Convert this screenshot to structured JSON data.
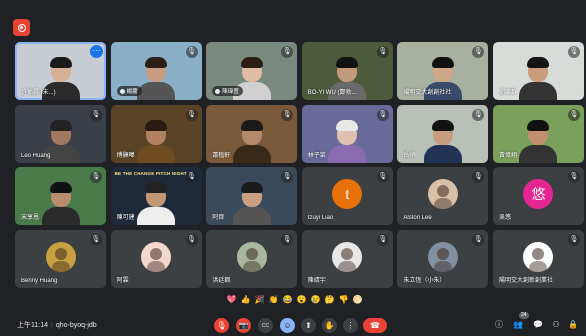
{
  "meeting": {
    "time": "上午11:14",
    "separator": "|",
    "code": "qho-byoq-jdb",
    "participant_count": "24"
  },
  "colors": {
    "background": "#202124",
    "tile": "#3c4043",
    "end_call": "#ea4335",
    "active_border": "#8ab4f8"
  },
  "tiles": [
    {
      "name": "許佑昇 (未...)",
      "kind": "video",
      "bg": "#c8cdd4",
      "skin": "#d8b098",
      "hair": "#1a1a1a",
      "shirt": "#2a2a2a",
      "active": true,
      "more": true
    },
    {
      "name": "楊藺",
      "kind": "video",
      "style": "pill",
      "bg": "#8ab0c8",
      "skin": "#c99d84",
      "hair": "#2a2018",
      "shirt": "#555",
      "mic": true
    },
    {
      "name": "陳瑋萱",
      "kind": "video",
      "style": "pill",
      "bg": "#7a8a80",
      "skin": "#e0bca6",
      "hair": "#2a1e16",
      "shirt": "#d0d0d0",
      "mic": true
    },
    {
      "name": "BO-YI WU (鄭勃...",
      "kind": "video",
      "bg": "#4d5a3c",
      "skin": "#c49a7c",
      "hair": "#111",
      "shirt": "#6a6a6a",
      "mic": true
    },
    {
      "name": "陽明交大創創社社",
      "kind": "video",
      "bg": "#a8b0a0",
      "skin": "#d0a888",
      "hair": "#111",
      "shirt": "#3a4a6a",
      "mic": true
    },
    {
      "name": "劉樂群",
      "kind": "video",
      "bg": "#d8dcd8",
      "skin": "#c89c7c",
      "hair": "#151515",
      "shirt": "#333",
      "mic": true
    },
    {
      "name": "Leo Huang",
      "kind": "video",
      "bg": "#3a3f48",
      "skin": "#a07860",
      "hair": "#222",
      "shirt": "#444",
      "mic": true
    },
    {
      "name": "傅顥暐",
      "kind": "video",
      "bg": "#5a4428",
      "skin": "#b08060",
      "hair": "#2a1a10",
      "shirt": "#704a20",
      "mic": true
    },
    {
      "name": "蕭植軒",
      "kind": "video",
      "bg": "#7a5a3a",
      "skin": "#b48a6c",
      "hair": "#1a1a1a",
      "shirt": "#3a2a1a",
      "mic": true
    },
    {
      "name": "林子菜",
      "kind": "video",
      "bg": "#6a6a9a",
      "skin": "#e0c0b0",
      "hair": "#e8e8e8",
      "shirt": "#8a6ab0",
      "mic": true
    },
    {
      "name": "岳峭",
      "kind": "video",
      "bg": "#b8c0b8",
      "skin": "#c89c80",
      "hair": "#111",
      "shirt": "#223355",
      "mic": true
    },
    {
      "name": "黃偉翔",
      "kind": "video",
      "bg": "#7aa05a",
      "skin": "#c09070",
      "hair": "#111",
      "shirt": "#333",
      "mic": true
    },
    {
      "name": "宋享恩",
      "kind": "video",
      "bg": "#4a7a4a",
      "skin": "#b88c6c",
      "hair": "#111",
      "shirt": "#2a2a2a",
      "mic": true
    },
    {
      "name": "陳可建",
      "kind": "video",
      "bg": "#1e2a3a",
      "skin": "#c09878",
      "hair": "#222",
      "shirt": "#eee",
      "mic": true,
      "banner": "BE THE CHANGE PITCH NIGHT"
    },
    {
      "name": "阿齊",
      "kind": "video",
      "bg": "#3a4a5a",
      "skin": "#c8a084",
      "hair": "#1a1a1a",
      "shirt": "#555",
      "mic": true
    },
    {
      "name": "tzuyi Liao",
      "kind": "avatar",
      "letter": "t",
      "avatar_bg": "#e8710a",
      "mic": true
    },
    {
      "name": "Alston Lee",
      "kind": "avatar",
      "letter": "",
      "avatar_bg": "#d8c0a8",
      "mic": true
    },
    {
      "name": "吳悠",
      "kind": "avatar",
      "letter": "悠",
      "avatar_bg": "#e52592",
      "mic": true
    },
    {
      "name": "Benny Huang",
      "kind": "avatar",
      "letter": "",
      "avatar_bg": "#c8a040",
      "mic": true
    },
    {
      "name": "阿霖",
      "kind": "avatar",
      "letter": "",
      "avatar_bg": "#f4d8d0",
      "mic": true
    },
    {
      "name": "洪廷鋼",
      "kind": "avatar",
      "letter": "",
      "avatar_bg": "#a8b8a0",
      "mic": true
    },
    {
      "name": "陳靖宇",
      "kind": "avatar",
      "letter": "",
      "avatar_bg": "#e8e8e8",
      "mic": true
    },
    {
      "name": "朱立恆（小朱）",
      "kind": "avatar",
      "letter": "",
      "avatar_bg": "#8090a0",
      "mic": true
    },
    {
      "name": "陽明交大創新創業社",
      "kind": "avatar",
      "letter": "",
      "avatar_bg": "#ffffff",
      "mic": true
    }
  ],
  "reactions": [
    "💖",
    "👍",
    "🎉",
    "👏",
    "😂",
    "😮",
    "😢",
    "🤔",
    "👎",
    "🌕"
  ],
  "controls": [
    {
      "name": "mic-off-button",
      "icon": "🎙",
      "style": "red"
    },
    {
      "name": "camera-off-button",
      "icon": "📷",
      "style": "red"
    },
    {
      "name": "captions-button",
      "icon": "CC",
      "style": ""
    },
    {
      "name": "emoji-button",
      "icon": "☺",
      "style": "blue"
    },
    {
      "name": "present-button",
      "icon": "⬆",
      "style": ""
    },
    {
      "name": "raise-hand-button",
      "icon": "✋",
      "style": ""
    },
    {
      "name": "more-options-button",
      "icon": "⋮",
      "style": ""
    },
    {
      "name": "end-call-button",
      "icon": "☎",
      "style": "end"
    }
  ],
  "right_controls": [
    {
      "name": "meeting-info-icon",
      "icon": "ⓘ"
    },
    {
      "name": "people-icon",
      "icon": "👥"
    },
    {
      "name": "chat-icon",
      "icon": "💬"
    },
    {
      "name": "activities-icon",
      "icon": "⚇"
    },
    {
      "name": "host-controls-icon",
      "icon": "🔒"
    }
  ]
}
